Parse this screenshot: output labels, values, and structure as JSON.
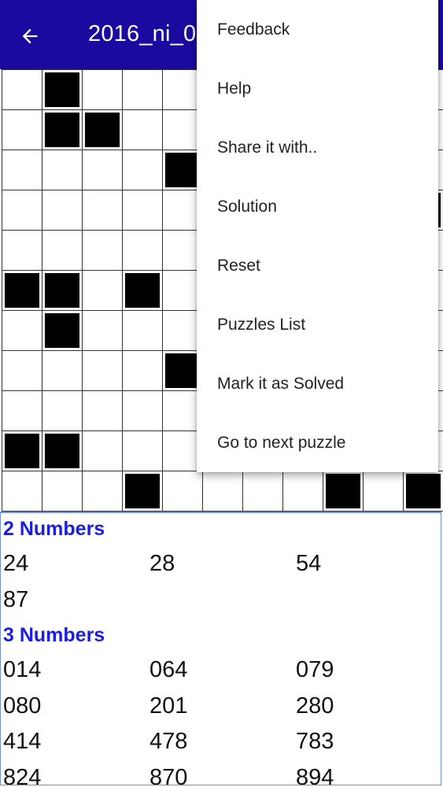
{
  "appbar": {
    "title": "2016_ni_0",
    "back_icon": "arrow-left-icon",
    "background": "#1a0aa0"
  },
  "grid": {
    "rows": 11,
    "cols": 11,
    "black_cells": [
      [
        0,
        1
      ],
      [
        1,
        1
      ],
      [
        1,
        2
      ],
      [
        2,
        4
      ],
      [
        3,
        10
      ],
      [
        5,
        0
      ],
      [
        5,
        1
      ],
      [
        5,
        3
      ],
      [
        6,
        1
      ],
      [
        7,
        4
      ],
      [
        9,
        0
      ],
      [
        9,
        1
      ],
      [
        10,
        3
      ],
      [
        10,
        8
      ],
      [
        10,
        10
      ]
    ]
  },
  "sections": [
    {
      "title": "2 Numbers",
      "rows": [
        [
          "24",
          "28",
          "54"
        ],
        [
          "87"
        ]
      ]
    },
    {
      "title": "3 Numbers",
      "rows": [
        [
          "014",
          "064",
          "079"
        ],
        [
          "080",
          "201",
          "280"
        ],
        [
          "414",
          "478",
          "783"
        ],
        [
          "824",
          "870",
          "894"
        ]
      ]
    }
  ],
  "menu": {
    "items": [
      {
        "label": "Feedback",
        "name": "menu-item-feedback"
      },
      {
        "label": "Help",
        "name": "menu-item-help"
      },
      {
        "label": "Share it with..",
        "name": "menu-item-share"
      },
      {
        "label": "Solution",
        "name": "menu-item-solution"
      },
      {
        "label": "Reset",
        "name": "menu-item-reset"
      },
      {
        "label": "Puzzles List",
        "name": "menu-item-puzzles-list"
      },
      {
        "label": "Mark it as Solved",
        "name": "menu-item-mark-solved"
      },
      {
        "label": "Go to next puzzle",
        "name": "menu-item-next-puzzle"
      }
    ]
  },
  "colors": {
    "accent": "#1a0aa0",
    "section_title": "#1a1ee0"
  }
}
